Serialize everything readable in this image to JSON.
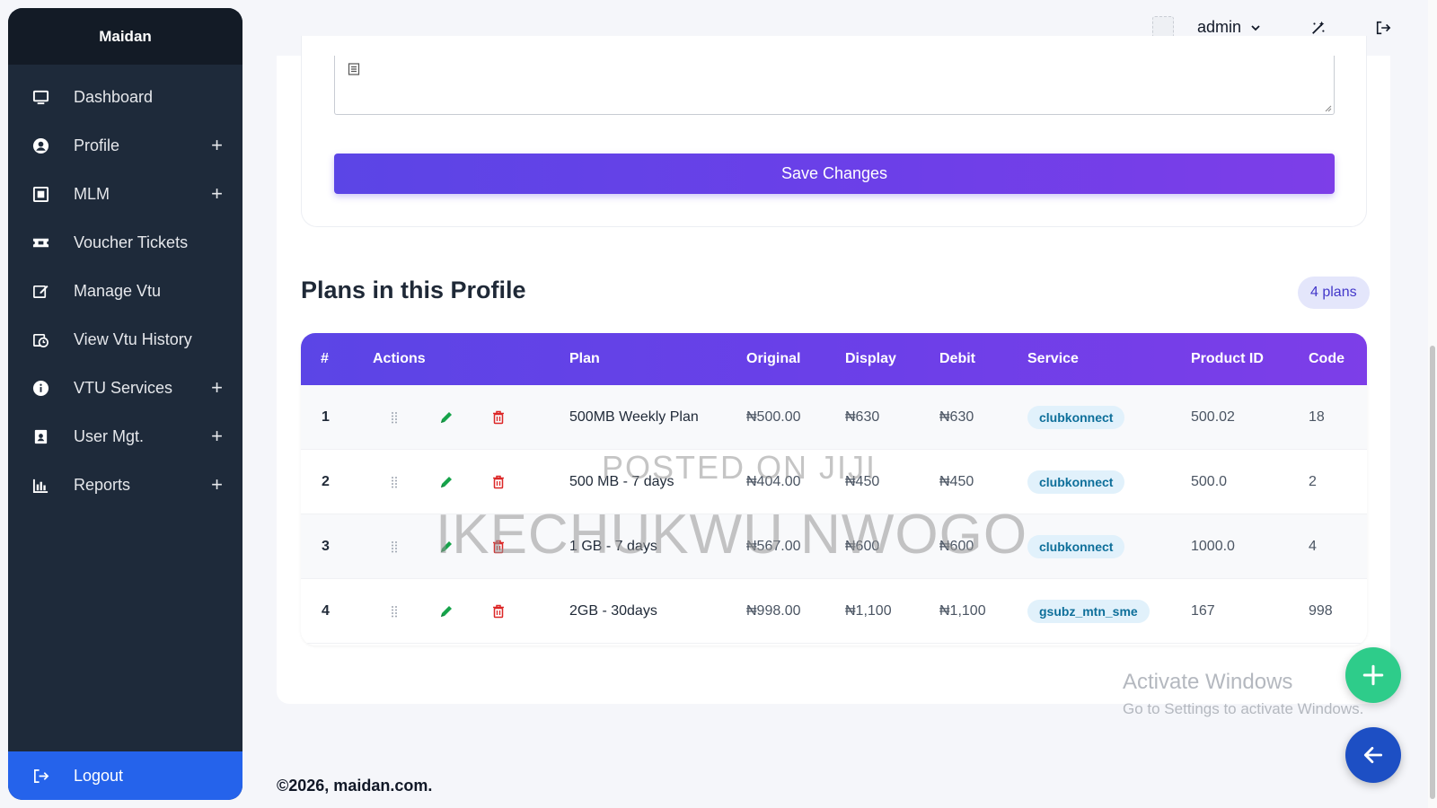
{
  "sidebar": {
    "brand": "Maidan",
    "items": [
      {
        "label": "Dashboard",
        "expandable": false,
        "icon": "monitor-icon"
      },
      {
        "label": "Profile",
        "expandable": true,
        "icon": "user-circle-icon"
      },
      {
        "label": "MLM",
        "expandable": true,
        "icon": "square-dot-icon"
      },
      {
        "label": "Voucher Tickets",
        "expandable": false,
        "icon": "ticket-icon"
      },
      {
        "label": "Manage Vtu",
        "expandable": false,
        "icon": "edit-box-icon"
      },
      {
        "label": "View Vtu History",
        "expandable": false,
        "icon": "history-icon"
      },
      {
        "label": "VTU Services",
        "expandable": true,
        "icon": "info-icon"
      },
      {
        "label": "User Mgt.",
        "expandable": true,
        "icon": "user-id-icon"
      },
      {
        "label": "Reports",
        "expandable": true,
        "icon": "bar-chart-icon"
      }
    ],
    "logout": "Logout"
  },
  "topbar": {
    "username": "admin"
  },
  "form": {
    "save_label": "Save Changes"
  },
  "plans": {
    "title": "Plans in this Profile",
    "count_badge": "4 plans",
    "columns": [
      "#",
      "Actions",
      "Plan",
      "Original",
      "Display",
      "Debit",
      "Service",
      "Product ID",
      "Code"
    ],
    "rows": [
      {
        "index": "1",
        "plan": "500MB Weekly Plan",
        "original": "₦500.00",
        "display": "₦630",
        "debit": "₦630",
        "service": "clubkonnect",
        "product_id": "500.02",
        "code": "18"
      },
      {
        "index": "2",
        "plan": "500 MB - 7 days",
        "original": "₦404.00",
        "display": "₦450",
        "debit": "₦450",
        "service": "clubkonnect",
        "product_id": "500.0",
        "code": "2"
      },
      {
        "index": "3",
        "plan": "1 GB - 7 days",
        "original": "₦567.00",
        "display": "₦600",
        "debit": "₦600",
        "service": "clubkonnect",
        "product_id": "1000.0",
        "code": "4"
      },
      {
        "index": "4",
        "plan": "2GB - 30days",
        "original": "₦998.00",
        "display": "₦1,100",
        "debit": "₦1,100",
        "service": "gsubz_mtn_sme",
        "product_id": "167",
        "code": "998"
      }
    ]
  },
  "watermark": {
    "line1": "POSTED ON JIJI",
    "line2": "IKECHUKWU NWOGO"
  },
  "activation": {
    "title": "Activate Windows",
    "subtitle": "Go to Settings to activate Windows."
  },
  "footer": {
    "text": "©2026, maidan.com."
  },
  "colors": {
    "sidebar_bg": "#1e2a3a",
    "accent_purple": "#6c3fe8",
    "logout_blue": "#2563eb",
    "edit_green": "#16a34a",
    "delete_red": "#dc2626",
    "fab_green": "#2ecc8a",
    "fab_blue": "#1d4fc4"
  }
}
